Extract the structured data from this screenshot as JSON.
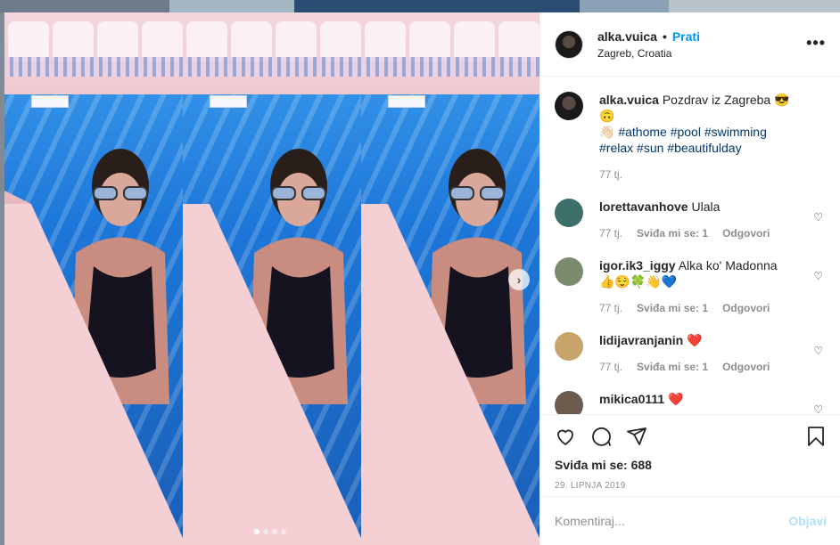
{
  "background": {
    "colors": [
      "#6c7b87",
      "#a4b6c2",
      "#4a6f94",
      "#8aa1b5",
      "#b9c3cc"
    ]
  },
  "post": {
    "author": "alka.vuica",
    "separator": "•",
    "follow_label": "Prati",
    "location": "Zagreb, Croatia",
    "more_icon": "more-horizontal-icon",
    "media": {
      "panel_count": 3,
      "dots": 4,
      "active_dot": 0,
      "next_icon": "chevron-right-icon"
    }
  },
  "caption": {
    "username": "alka.vuica",
    "text": "Pozdrav iz Zagreba 😎🙃",
    "line2_emoji": "👋🏻",
    "hashtags_line2": [
      "#athome",
      "#pool",
      "#swimming"
    ],
    "hashtags_line3": [
      "#relax",
      "#sun",
      "#beautifulday"
    ],
    "time": "77 tj."
  },
  "comments": [
    {
      "username": "lorettavanhove",
      "text": "Ulala",
      "time": "77 tj.",
      "likes": "Sviđa mi se: 1",
      "reply": "Odgovori",
      "avatar_color": "#3c6e6a"
    },
    {
      "username": "igor.ik3_iggy",
      "text": "Alka ko' Madonna",
      "emoji": "👍😌🍀👋💙",
      "time": "77 tj.",
      "likes": "Sviđa mi se: 1",
      "reply": "Odgovori",
      "avatar_color": "#7b8c6e"
    },
    {
      "username": "lidijavranjanin",
      "text": "❤️",
      "time": "77 tj.",
      "likes": "Sviđa mi se: 1",
      "reply": "Odgovori",
      "avatar_color": "#c9a46a"
    },
    {
      "username": "mikica0111",
      "text": "❤️",
      "avatar_color": "#6b5a4d"
    }
  ],
  "actions": {
    "like_icon": "heart-icon",
    "comment_icon": "comment-icon",
    "share_icon": "send-icon",
    "save_icon": "bookmark-icon",
    "likes_text": "Sviđa mi se: 688",
    "date": "29. LIPNJA 2019"
  },
  "composer": {
    "placeholder": "Komentiraj...",
    "post_label": "Objavi"
  }
}
